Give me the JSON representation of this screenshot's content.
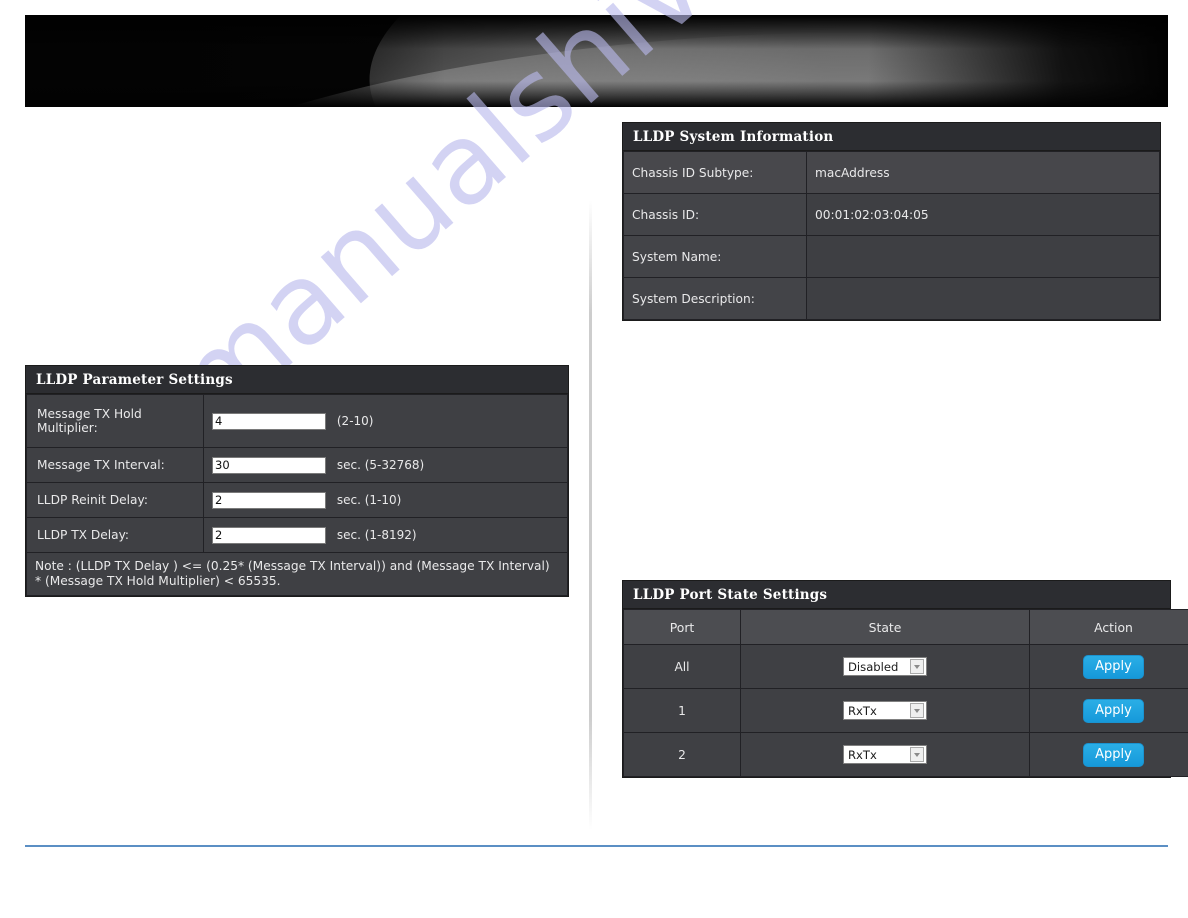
{
  "page": {
    "watermark": "manualshive.com",
    "accent_blue": "#1699da",
    "footer_rule_color": "#5b8fc4",
    "panel_title_bg": "#2c2d31",
    "panel_row_bg": "#3f4044"
  },
  "system_info": {
    "title": "LLDP System Information",
    "rows": [
      {
        "label": "Chassis ID Subtype:",
        "value": "macAddress"
      },
      {
        "label": "Chassis ID:",
        "value": "00:01:02:03:04:05"
      },
      {
        "label": "System Name:",
        "value": ""
      },
      {
        "label": "System Description:",
        "value": ""
      }
    ]
  },
  "parameter_settings": {
    "title": "LLDP Parameter Settings",
    "rows": [
      {
        "label": "Message TX Hold Multiplier:",
        "value": "4",
        "hint": "(2-10)"
      },
      {
        "label": "Message TX Interval:",
        "value": "30",
        "hint": "sec. (5-32768)"
      },
      {
        "label": "LLDP Reinit Delay:",
        "value": "2",
        "hint": "sec.  (1-10)"
      },
      {
        "label": "LLDP TX Delay:",
        "value": "2",
        "hint": "sec. (1-8192)"
      }
    ],
    "note": "Note : (LLDP TX Delay ) <= (0.25* (Message TX Interval)) and (Message TX Interval) * (Message TX Hold Multiplier) < 65535."
  },
  "port_state_settings": {
    "title": "LLDP Port State Settings",
    "columns": [
      "Port",
      "State",
      "Action"
    ],
    "rows": [
      {
        "port": "All",
        "state": "Disabled",
        "action": "Apply"
      },
      {
        "port": "1",
        "state": "RxTx",
        "action": "Apply"
      },
      {
        "port": "2",
        "state": "RxTx",
        "action": "Apply"
      }
    ]
  }
}
